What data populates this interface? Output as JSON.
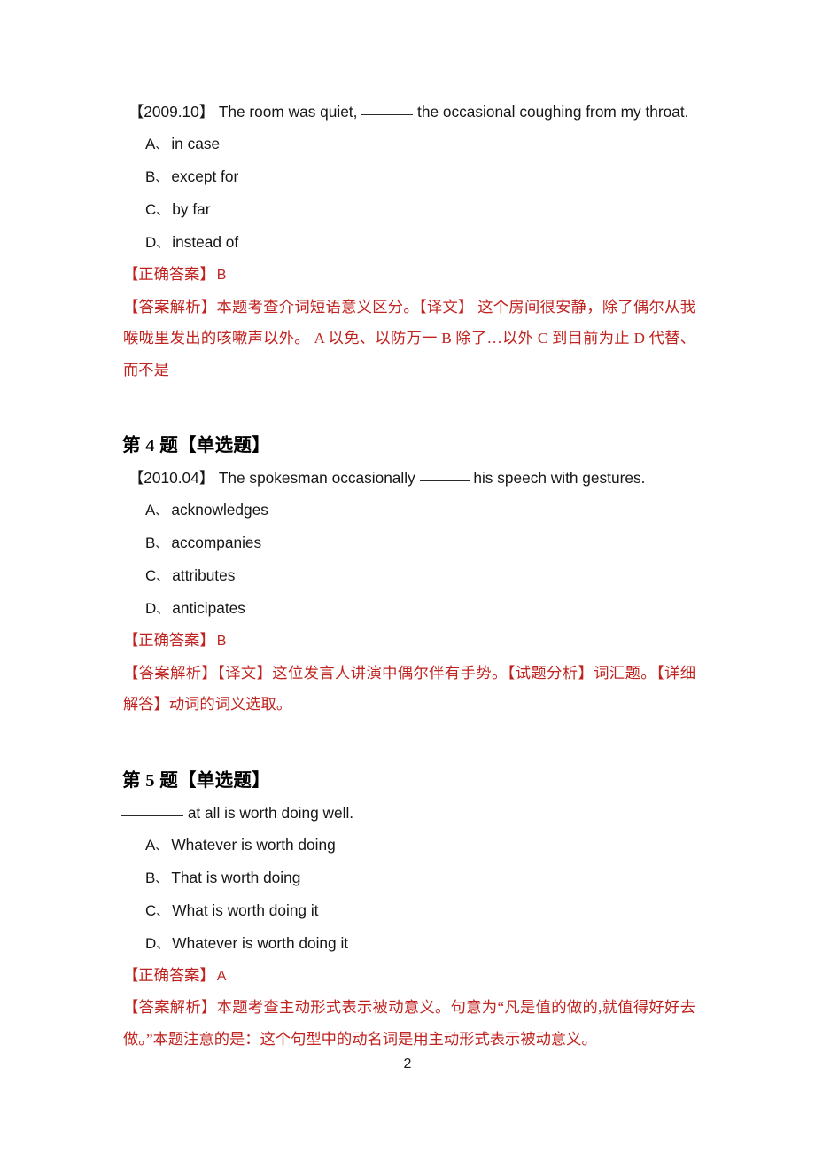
{
  "document": {
    "page_number": "2",
    "accent_red": "#c0231f",
    "text_color": "#161616",
    "background": "#ffffff"
  },
  "questions": [
    {
      "heading": "",
      "source_tag": "【2009.10】",
      "stem_before": "The room was quiet,",
      "stem_after": "the occasional coughing from my throat.",
      "options": [
        {
          "letter": "A",
          "sep": "、",
          "text": "in case"
        },
        {
          "letter": "B",
          "sep": "、",
          "text": "except for"
        },
        {
          "letter": "C",
          "sep": "、",
          "text": "by far"
        },
        {
          "letter": "D",
          "sep": "、",
          "text": "instead of"
        }
      ],
      "answer_label": "【正确答案】",
      "answer_letter": "B",
      "analysis": "【答案解析】本题考查介词短语意义区分。【译文】 这个房间很安静，除了偶尔从我喉咙里发出的咳嗽声以外。 A 以免、以防万一  B 除了…以外  C 到目前为止  D 代替、而不是"
    },
    {
      "heading": "第 4 题【单选题】",
      "source_tag": "【2010.04】",
      "stem_before": "The spokesman occasionally",
      "stem_after": "his speech with gestures.",
      "options": [
        {
          "letter": "A",
          "sep": "、",
          "text": "acknowledges"
        },
        {
          "letter": "B",
          "sep": "、",
          "text": "accompanies"
        },
        {
          "letter": "C",
          "sep": "、",
          "text": "attributes"
        },
        {
          "letter": "D",
          "sep": "、",
          "text": "anticipates"
        }
      ],
      "answer_label": "【正确答案】",
      "answer_letter": "B",
      "analysis": "【答案解析】【译文】这位发言人讲演中偶尔伴有手势。【试题分析】词汇题。【详细解答】动词的词义选取。"
    },
    {
      "heading": "第 5 题【单选题】",
      "source_tag": "",
      "stem_before": "",
      "stem_after": "at all is worth doing well.",
      "options": [
        {
          "letter": "A",
          "sep": "、",
          "text": "Whatever is worth doing"
        },
        {
          "letter": "B",
          "sep": "、",
          "text": "That is worth doing"
        },
        {
          "letter": "C",
          "sep": "、",
          "text": "What is worth doing it"
        },
        {
          "letter": "D",
          "sep": "、",
          "text": "Whatever is worth doing it"
        }
      ],
      "answer_label": "【正确答案】",
      "answer_letter": "A",
      "analysis": "【答案解析】本题考查主动形式表示被动意义。句意为“凡是值的做的,就值得好好去做。”本题注意的是：这个句型中的动名词是用主动形式表示被动意义。"
    }
  ]
}
